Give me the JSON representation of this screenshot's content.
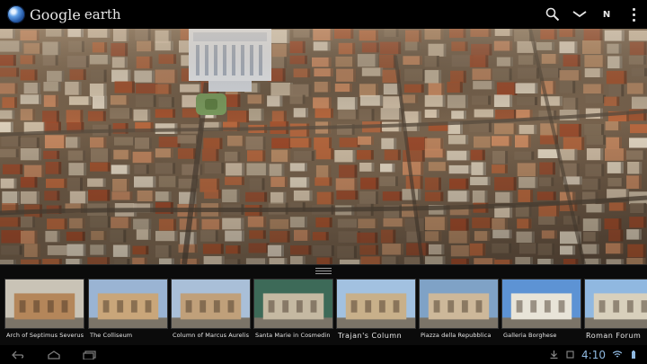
{
  "app": {
    "brand_name": "Google",
    "brand_sub": "earth",
    "compass_label": "N"
  },
  "icons": {
    "logo": "globe-icon",
    "search": "search-icon",
    "layers": "chevron-down-icon",
    "compass": "compass-icon",
    "overflow": "overflow-menu-icon",
    "handle": "drag-handle-icon",
    "back": "back-icon",
    "home": "home-icon",
    "recent": "recent-apps-icon"
  },
  "tours": [
    {
      "label": "Arch of Septimus Severus",
      "sky": "#c9c3b6",
      "body": "#b4865a"
    },
    {
      "label": "The Colliseum",
      "sky": "#9ab4d3",
      "body": "#c9a67a"
    },
    {
      "label": "Column of Marcus Aurelis",
      "sky": "#a9bfd8",
      "body": "#c0a07a"
    },
    {
      "label": "Santa Marie in Cosmedin",
      "sky": "#3d6a58",
      "body": "#c5b9a2"
    },
    {
      "label": "Trajan's Column",
      "sky": "#a2c1e0",
      "body": "#c8b08a"
    },
    {
      "label": "Piazza della Repubblica",
      "sky": "#7fa2c6",
      "body": "#cdb89a"
    },
    {
      "label": "Galleria Borghese",
      "sky": "#5d93d4",
      "body": "#e8e4d8"
    },
    {
      "label": "Roman Forum",
      "sky": "#90b8e0",
      "body": "#d8d0bc"
    }
  ],
  "status": {
    "clock": "4:10"
  },
  "colors": {
    "bar_bg": "#000000",
    "strip_bg": "#0b0b0b",
    "clock": "#8fb8e0"
  }
}
